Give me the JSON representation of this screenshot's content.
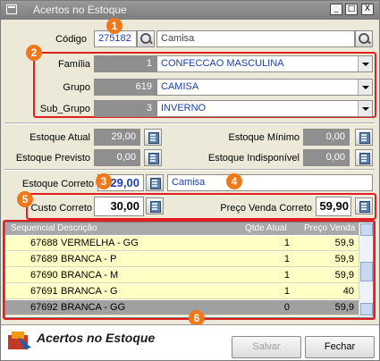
{
  "window": {
    "title": "Acertos no Estoque",
    "btn_min": "_",
    "btn_max": "□",
    "btn_close": "X"
  },
  "codigo": {
    "label": "Código",
    "value": "275182",
    "desc": "Camisa"
  },
  "familia": {
    "label": "Família",
    "code": "1",
    "value": "CONFECCAO MASCULINA"
  },
  "grupo": {
    "label": "Grupo",
    "code": "619",
    "value": "CAMISA"
  },
  "sub_grupo": {
    "label": "Sub_Grupo",
    "code": "3",
    "value": "INVERNO"
  },
  "estoque_atual": {
    "label": "Estoque Atual",
    "value": "29,00"
  },
  "estoque_minimo": {
    "label": "Estoque Mínimo",
    "value": "0,00"
  },
  "estoque_previsto": {
    "label": "Estoque Previsto",
    "value": "0,00"
  },
  "estoque_indisponivel": {
    "label": "Estoque Indisponível",
    "value": "0,00"
  },
  "estoque_correto": {
    "label": "Estoque Correto",
    "value": "29,00",
    "desc": "Camisa"
  },
  "custo_correto": {
    "label": "Custo Correto",
    "value": "30,00"
  },
  "preco_venda_correto": {
    "label": "Preço Venda Correto",
    "value": "59,90"
  },
  "grid": {
    "headers": {
      "seq": "Sequencial",
      "desc": "Descrição",
      "qtde": "Qtde Atual",
      "preco": "Preço Venda"
    },
    "rows": [
      {
        "seq": "67688",
        "desc": "VERMELHA - GG",
        "qtde": "1",
        "preco": "59,9"
      },
      {
        "seq": "67689",
        "desc": "BRANCA - P",
        "qtde": "1",
        "preco": "59,9"
      },
      {
        "seq": "67690",
        "desc": "BRANCA - M",
        "qtde": "1",
        "preco": "59,9"
      },
      {
        "seq": "67691",
        "desc": "BRANCA - G",
        "qtde": "1",
        "preco": "40"
      },
      {
        "seq": "67692",
        "desc": "BRANCA - GG",
        "qtde": "0",
        "preco": "59,9"
      }
    ]
  },
  "badges": {
    "b1": "1",
    "b2": "2",
    "b3": "3",
    "b4": "4",
    "b5": "5",
    "b6": "6"
  },
  "footer": {
    "title": "Acertos no Estoque",
    "salvar": "Salvar",
    "fechar": "Fechar"
  },
  "colors": {
    "highlight": "#e02020",
    "badge": "#f07818",
    "grid_row": "#ffffc6"
  }
}
